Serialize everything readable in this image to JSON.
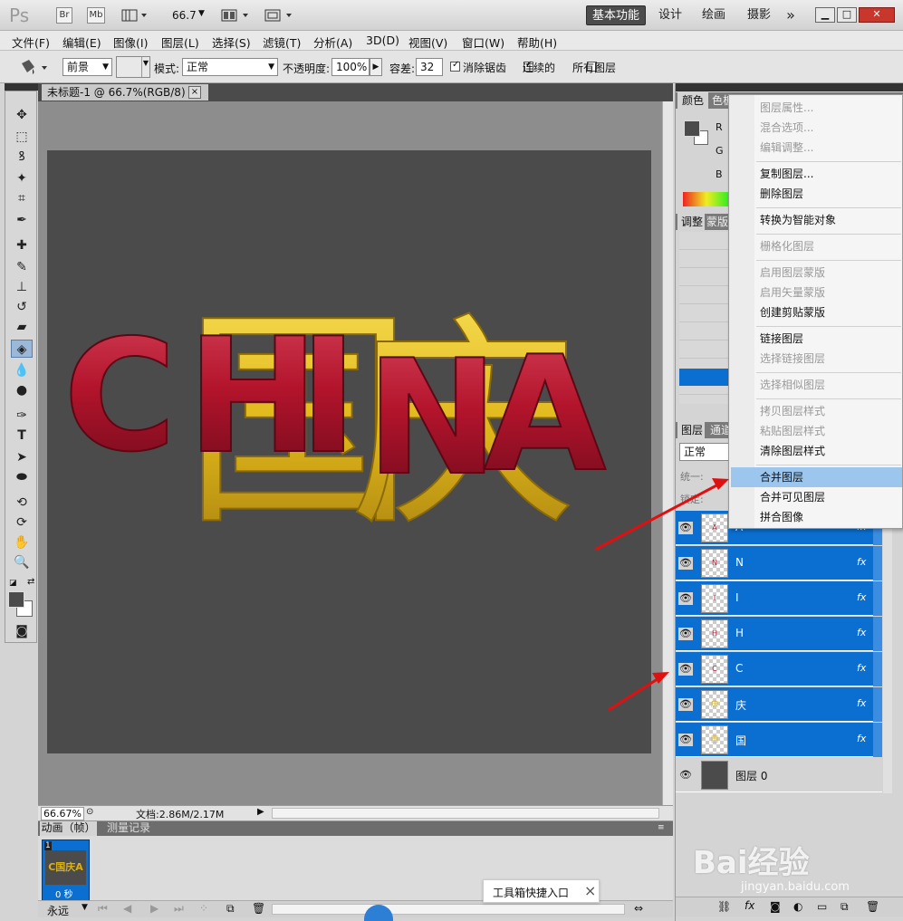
{
  "titlebar": {
    "logo": "Ps",
    "bridge_btn": "Br",
    "minibridge_btn": "Mb",
    "zoom_value": "66.7",
    "workspaces": [
      "基本功能",
      "设计",
      "绘画",
      "摄影"
    ],
    "more": "»"
  },
  "menubar": [
    "文件(F)",
    "编辑(E)",
    "图像(I)",
    "图层(L)",
    "选择(S)",
    "滤镜(T)",
    "分析(A)",
    "3D(D)",
    "视图(V)",
    "窗口(W)",
    "帮助(H)"
  ],
  "options": {
    "fill_source": "前景",
    "mode_label": "模式:",
    "mode_value": "正常",
    "opacity_label": "不透明度:",
    "opacity_value": "100%",
    "tolerance_label": "容差:",
    "tolerance_value": "32",
    "antialias_label": "消除锯齿",
    "contiguous_label": "连续的",
    "all_layers_label": "所有图层"
  },
  "document": {
    "tab_title": "未标题-1 @ 66.7%(RGB/8) *",
    "close": "×",
    "zoom_status": "66.67%",
    "doc_status": "文档:2.86M/2.17M",
    "canvas_text": [
      "C",
      "国",
      "H",
      "I",
      "庆",
      "N",
      "A"
    ]
  },
  "animation": {
    "tabs": [
      "动画（帧）",
      "测量记录"
    ],
    "frame_number": "1",
    "frame_thumb_text": "C国庆A",
    "frame_delay": "0 秒",
    "loop": "永远"
  },
  "toolbox_tip": {
    "label": "工具箱快捷入口",
    "close": "×"
  },
  "right_panel": {
    "top_tabs": [
      "颜色",
      "色板"
    ],
    "color_channels": [
      "R",
      "G",
      "B"
    ],
    "mid_tabs": [
      "调整",
      "蒙版"
    ],
    "layer_tabs": [
      "图层",
      "通道"
    ],
    "blend_mode": "正常",
    "unify_label": "统一:",
    "lock_label": "锁定:"
  },
  "context_menu": {
    "items": [
      {
        "label": "图层属性...",
        "enabled": false
      },
      {
        "label": "混合选项...",
        "enabled": false
      },
      {
        "label": "编辑调整...",
        "enabled": false
      },
      {
        "label": "复制图层...",
        "enabled": true
      },
      {
        "label": "删除图层",
        "enabled": true
      },
      {
        "label": "转换为智能对象",
        "enabled": true
      },
      {
        "label": "栅格化图层",
        "enabled": false
      },
      {
        "label": "启用图层蒙版",
        "enabled": false
      },
      {
        "label": "启用矢量蒙版",
        "enabled": false
      },
      {
        "label": "创建剪贴蒙版",
        "enabled": true
      },
      {
        "label": "链接图层",
        "enabled": true
      },
      {
        "label": "选择链接图层",
        "enabled": false
      },
      {
        "label": "选择相似图层",
        "enabled": false
      },
      {
        "label": "拷贝图层样式",
        "enabled": false
      },
      {
        "label": "粘贴图层样式",
        "enabled": false
      },
      {
        "label": "清除图层样式",
        "enabled": true
      },
      {
        "label": "合并图层",
        "enabled": true,
        "highlighted": true
      },
      {
        "label": "合并可见图层",
        "enabled": true
      },
      {
        "label": "拼合图像",
        "enabled": true
      }
    ]
  },
  "layers": [
    {
      "name": "A",
      "thumb": "A",
      "fx": "fx",
      "selected": true
    },
    {
      "name": "N",
      "thumb": "N",
      "fx": "fx",
      "selected": true
    },
    {
      "name": "I",
      "thumb": "I",
      "fx": "fx",
      "selected": true
    },
    {
      "name": "H",
      "thumb": "H",
      "fx": "fx",
      "selected": true
    },
    {
      "name": "C",
      "thumb": "C",
      "fx": "fx",
      "selected": true
    },
    {
      "name": "庆",
      "thumb": "庆",
      "fx": "fx",
      "selected": true
    },
    {
      "name": "国",
      "thumb": "国",
      "fx": "fx",
      "selected": true
    },
    {
      "name": "图层 0",
      "thumb": "",
      "fx": "",
      "selected": false
    }
  ],
  "watermark": {
    "brand": "Bai经验",
    "url": "jingyan.baidu.com"
  },
  "colors": {
    "letter_red": "#b3142c",
    "letter_gold": "#e8c21d",
    "selected_layer": "#0a6fd0",
    "menu_highlight": "#9cc6ee",
    "arrow": "#e01010"
  }
}
